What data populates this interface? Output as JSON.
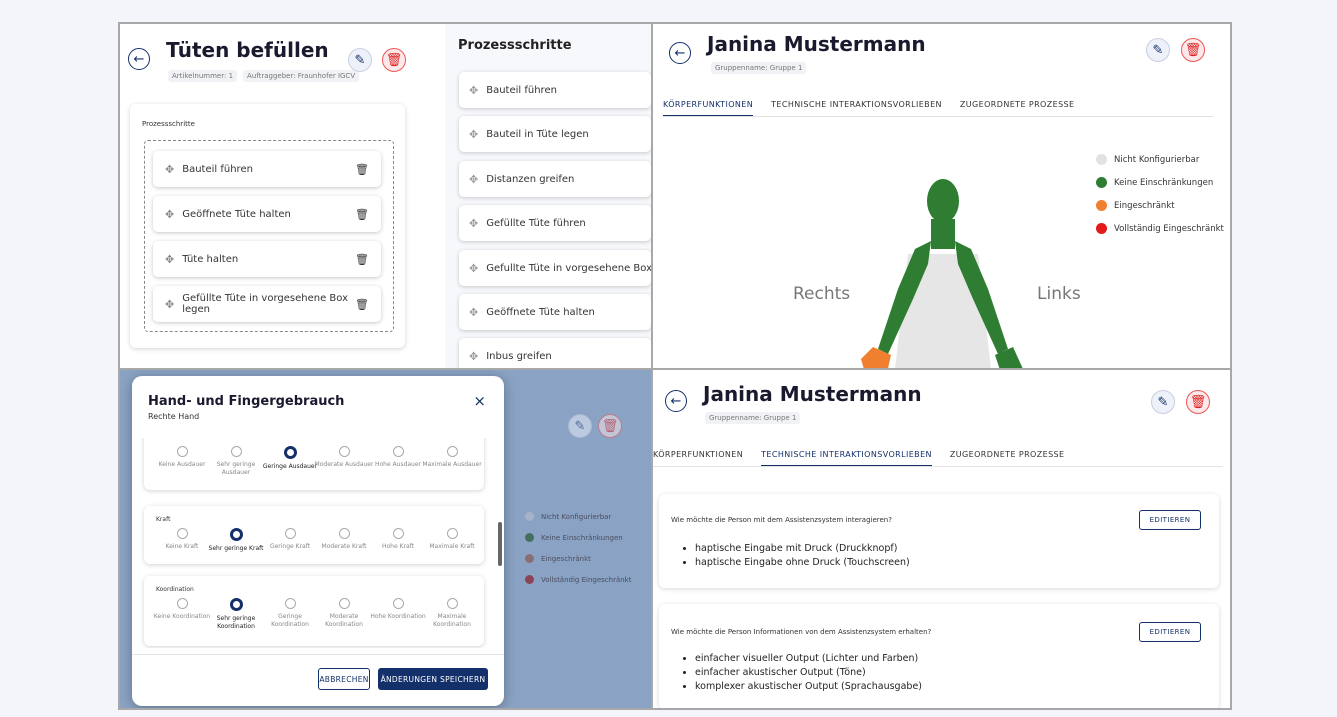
{
  "panel1": {
    "title": "Tüten befüllen",
    "meta": [
      "Artikelnummer: 1",
      "Auftraggeber: Fraunhofer IGCV"
    ],
    "section_label": "Prozessschritte",
    "steps": [
      "Bauteil führen",
      "Geöffnete Tüte halten",
      "Tüte halten",
      "Gefüllte Tüte in vorgesehene Box legen"
    ],
    "palette_title": "Prozessschritte",
    "palette": [
      "Bauteil führen",
      "Bauteil in Tüte legen",
      "Distanzen greifen",
      "Gefüllte Tüte führen",
      "Gefullte Tüte in vorgesehene Box legen",
      "Geöffnete Tüte halten",
      "Inbus greifen"
    ]
  },
  "panel2": {
    "name": "Janina Mustermann",
    "group": "Gruppenname: Gruppe 1",
    "tabs": [
      "KÖRPERFUNKTIONEN",
      "TECHNISCHE INTERAKTIONSVORLIEBEN",
      "ZUGEORDNETE PROZESSE"
    ],
    "right_label": "Rechts",
    "left_label": "Links",
    "legend": [
      {
        "label": "Nicht Konfigurierbar",
        "color": "#e2e2e2"
      },
      {
        "label": "Keine Einschränkungen",
        "color": "#2f7d32"
      },
      {
        "label": "Eingeschränkt",
        "color": "#f08030"
      },
      {
        "label": "Vollständig Eingeschränkt",
        "color": "#e11b1b"
      }
    ]
  },
  "panel3": {
    "modal_title": "Hand- und Fingergebrauch",
    "modal_subtitle": "Rechte Hand",
    "close": "×",
    "endurance": [
      "Keine Ausdauer",
      "Sehr geringe Ausdauer",
      "Geringe Ausdauer",
      "Moderate Ausdauer",
      "Hohe Ausdauer",
      "Maximale Ausdauer"
    ],
    "kraft_label": "Kraft",
    "kraft": [
      "Keine Kraft",
      "Sehr geringe Kraft",
      "Geringe Kraft",
      "Moderate Kraft",
      "Hohe Kraft",
      "Maximale Kraft"
    ],
    "koord_label": "Koordination",
    "koord": [
      "Keine Koordination",
      "Sehr geringe Koordination",
      "Geringe Koordination",
      "Moderate Koordination",
      "Hohe Koordination",
      "Maximale Koordination"
    ],
    "cancel": "ABBRECHEN",
    "save": "ÄNDERUNGEN SPEICHERN",
    "bg_legend": [
      "Nicht Konfigurierbar",
      "Keine Einschränkungen",
      "Eingeschränkt",
      "Vollständig Eingeschränkt"
    ]
  },
  "panel4": {
    "name": "Janina Mustermann",
    "group": "Gruppenname: Gruppe 1",
    "tabs": [
      "KÖRPERFUNKTIONEN",
      "TECHNISCHE INTERAKTIONSVORLIEBEN",
      "ZUGEORDNETE PROZESSE"
    ],
    "q1": "Wie möchte die Person mit dem Assistenzsystem interagieren?",
    "q1_items": [
      "haptische Eingabe mit Druck (Druckknopf)",
      "haptische Eingabe ohne Druck (Touchscreen)"
    ],
    "q2": "Wie möchte die Person Informationen von dem Assistenzsystem erhalten?",
    "q2_items": [
      "einfacher visueller Output (Lichter und Farben)",
      "einfacher akustischer Output (Töne)",
      "komplexer akustischer Output (Sprachausgabe)"
    ],
    "edit": "EDITIEREN"
  },
  "icons": [
    "back-arrow-icon",
    "pencil-icon",
    "trash-icon",
    "move-icon",
    "close-icon"
  ]
}
